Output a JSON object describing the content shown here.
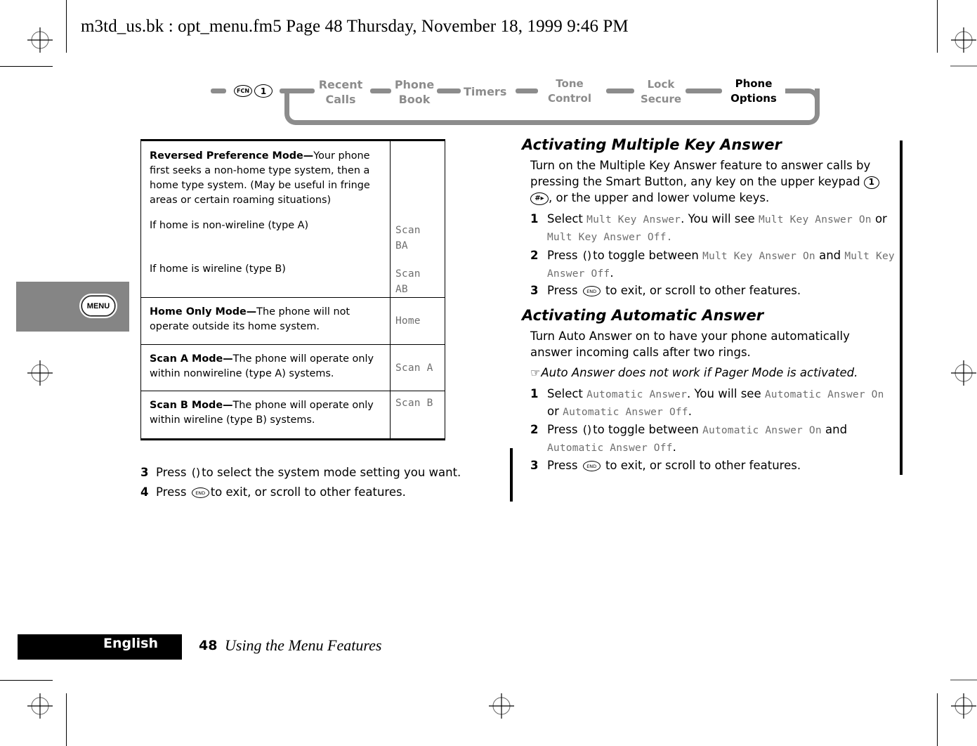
{
  "header": {
    "slug": "m3td_us.bk : opt_menu.fm5  Page 48  Thursday, November 18, 1999  9:46 PM"
  },
  "nav": {
    "keys": [
      "FCN",
      "1"
    ],
    "items": [
      {
        "line1": "Recent",
        "line2": "Calls",
        "active": false
      },
      {
        "line1": "Phone",
        "line2": "Book",
        "active": false
      },
      {
        "line1": "Timers",
        "line2": "",
        "active": false
      },
      {
        "line1": "Tone",
        "line2": "Control",
        "active": false
      },
      {
        "line1": "Lock",
        "line2": "Secure",
        "active": false
      },
      {
        "line1": "Phone",
        "line2": "Options",
        "active": true
      }
    ],
    "inactive_color": "#8c8c8c",
    "active_color": "#000000"
  },
  "side_tab": {
    "key_label": "MENU",
    "color": "#858585"
  },
  "table": {
    "rows": [
      {
        "title": "Reversed Preference Mode—",
        "desc": "Your phone first seeks a non-home type system, then a home type system. (May be useful in fringe areas or certain roaming situations)",
        "sub": [
          {
            "label": "If home is non-wireline (type A)",
            "value_line1": "Scan",
            "value_line2": "BA"
          },
          {
            "label": "If home is wireline (type B)",
            "value_line1": "Scan",
            "value_line2": "AB"
          }
        ]
      },
      {
        "title": "Home Only Mode—",
        "desc": "The phone will not operate outside its home system.",
        "value": "Home"
      },
      {
        "title": "Scan A Mode—",
        "desc": "The phone will operate only within nonwireline (type A) systems.",
        "value": "Scan A"
      },
      {
        "title": "Scan B Mode—",
        "desc": "The phone will operate only within wireline (type B) systems.",
        "value": "Scan B"
      }
    ]
  },
  "left_steps": [
    {
      "num": "3",
      "pre": "Press",
      "key": "()",
      "post": "to select the system mode setting you want."
    },
    {
      "num": "4",
      "pre": "Press",
      "key": "END",
      "post": "to exit, or scroll to other features."
    }
  ],
  "section1": {
    "title": "Activating Multiple Key Answer",
    "intro_a": "Turn on the Multiple Key Answer feature to answer calls by pressing the Smart Button, any key on the upper keypad",
    "intro_key1": "1",
    "intro_key2": "#▸",
    "intro_b": ", or the upper and lower volume keys.",
    "steps": [
      {
        "num": "1",
        "t1": "Select",
        "d1": "Mult Key Answer",
        "t2": ". You will see",
        "d2": "Mult Key Answer On",
        "t3": "or",
        "d3": "Mult Key Answer Off."
      },
      {
        "num": "2",
        "t1": "Press",
        "key": "()",
        "t2": "to toggle between",
        "d1": "Mult Key Answer On",
        "t3": "and",
        "d2": "Mult Key",
        "d3": "Answer Off",
        "t4": "."
      },
      {
        "num": "3",
        "t1": "Press",
        "key": "END",
        "t2": "to exit, or scroll to other features."
      }
    ]
  },
  "section2": {
    "title": "Activating Automatic Answer",
    "intro": "Turn Auto Answer on to have your phone automatically answer incoming calls after two rings.",
    "note_icon": "☞",
    "note": "Auto Answer does not work if Pager Mode is activated.",
    "steps": [
      {
        "num": "1",
        "t1": "Select",
        "d1": "Automatic Answer",
        "t2": ". You will see",
        "d2": "Automatic Answer On",
        "t3": "or",
        "d3": "Automatic Answer Off",
        "t4": "."
      },
      {
        "num": "2",
        "t1": "Press",
        "key": "()",
        "t2": "to toggle between",
        "d1": "Automatic Answer On",
        "t3": "and",
        "d2": "Automatic Answer Off",
        "t4": "."
      },
      {
        "num": "3",
        "t1": "Press",
        "key": "END",
        "t2": "to exit, or scroll to other features."
      }
    ]
  },
  "footer": {
    "language": "English",
    "page_number": "48",
    "title": "Using the Menu Features"
  }
}
